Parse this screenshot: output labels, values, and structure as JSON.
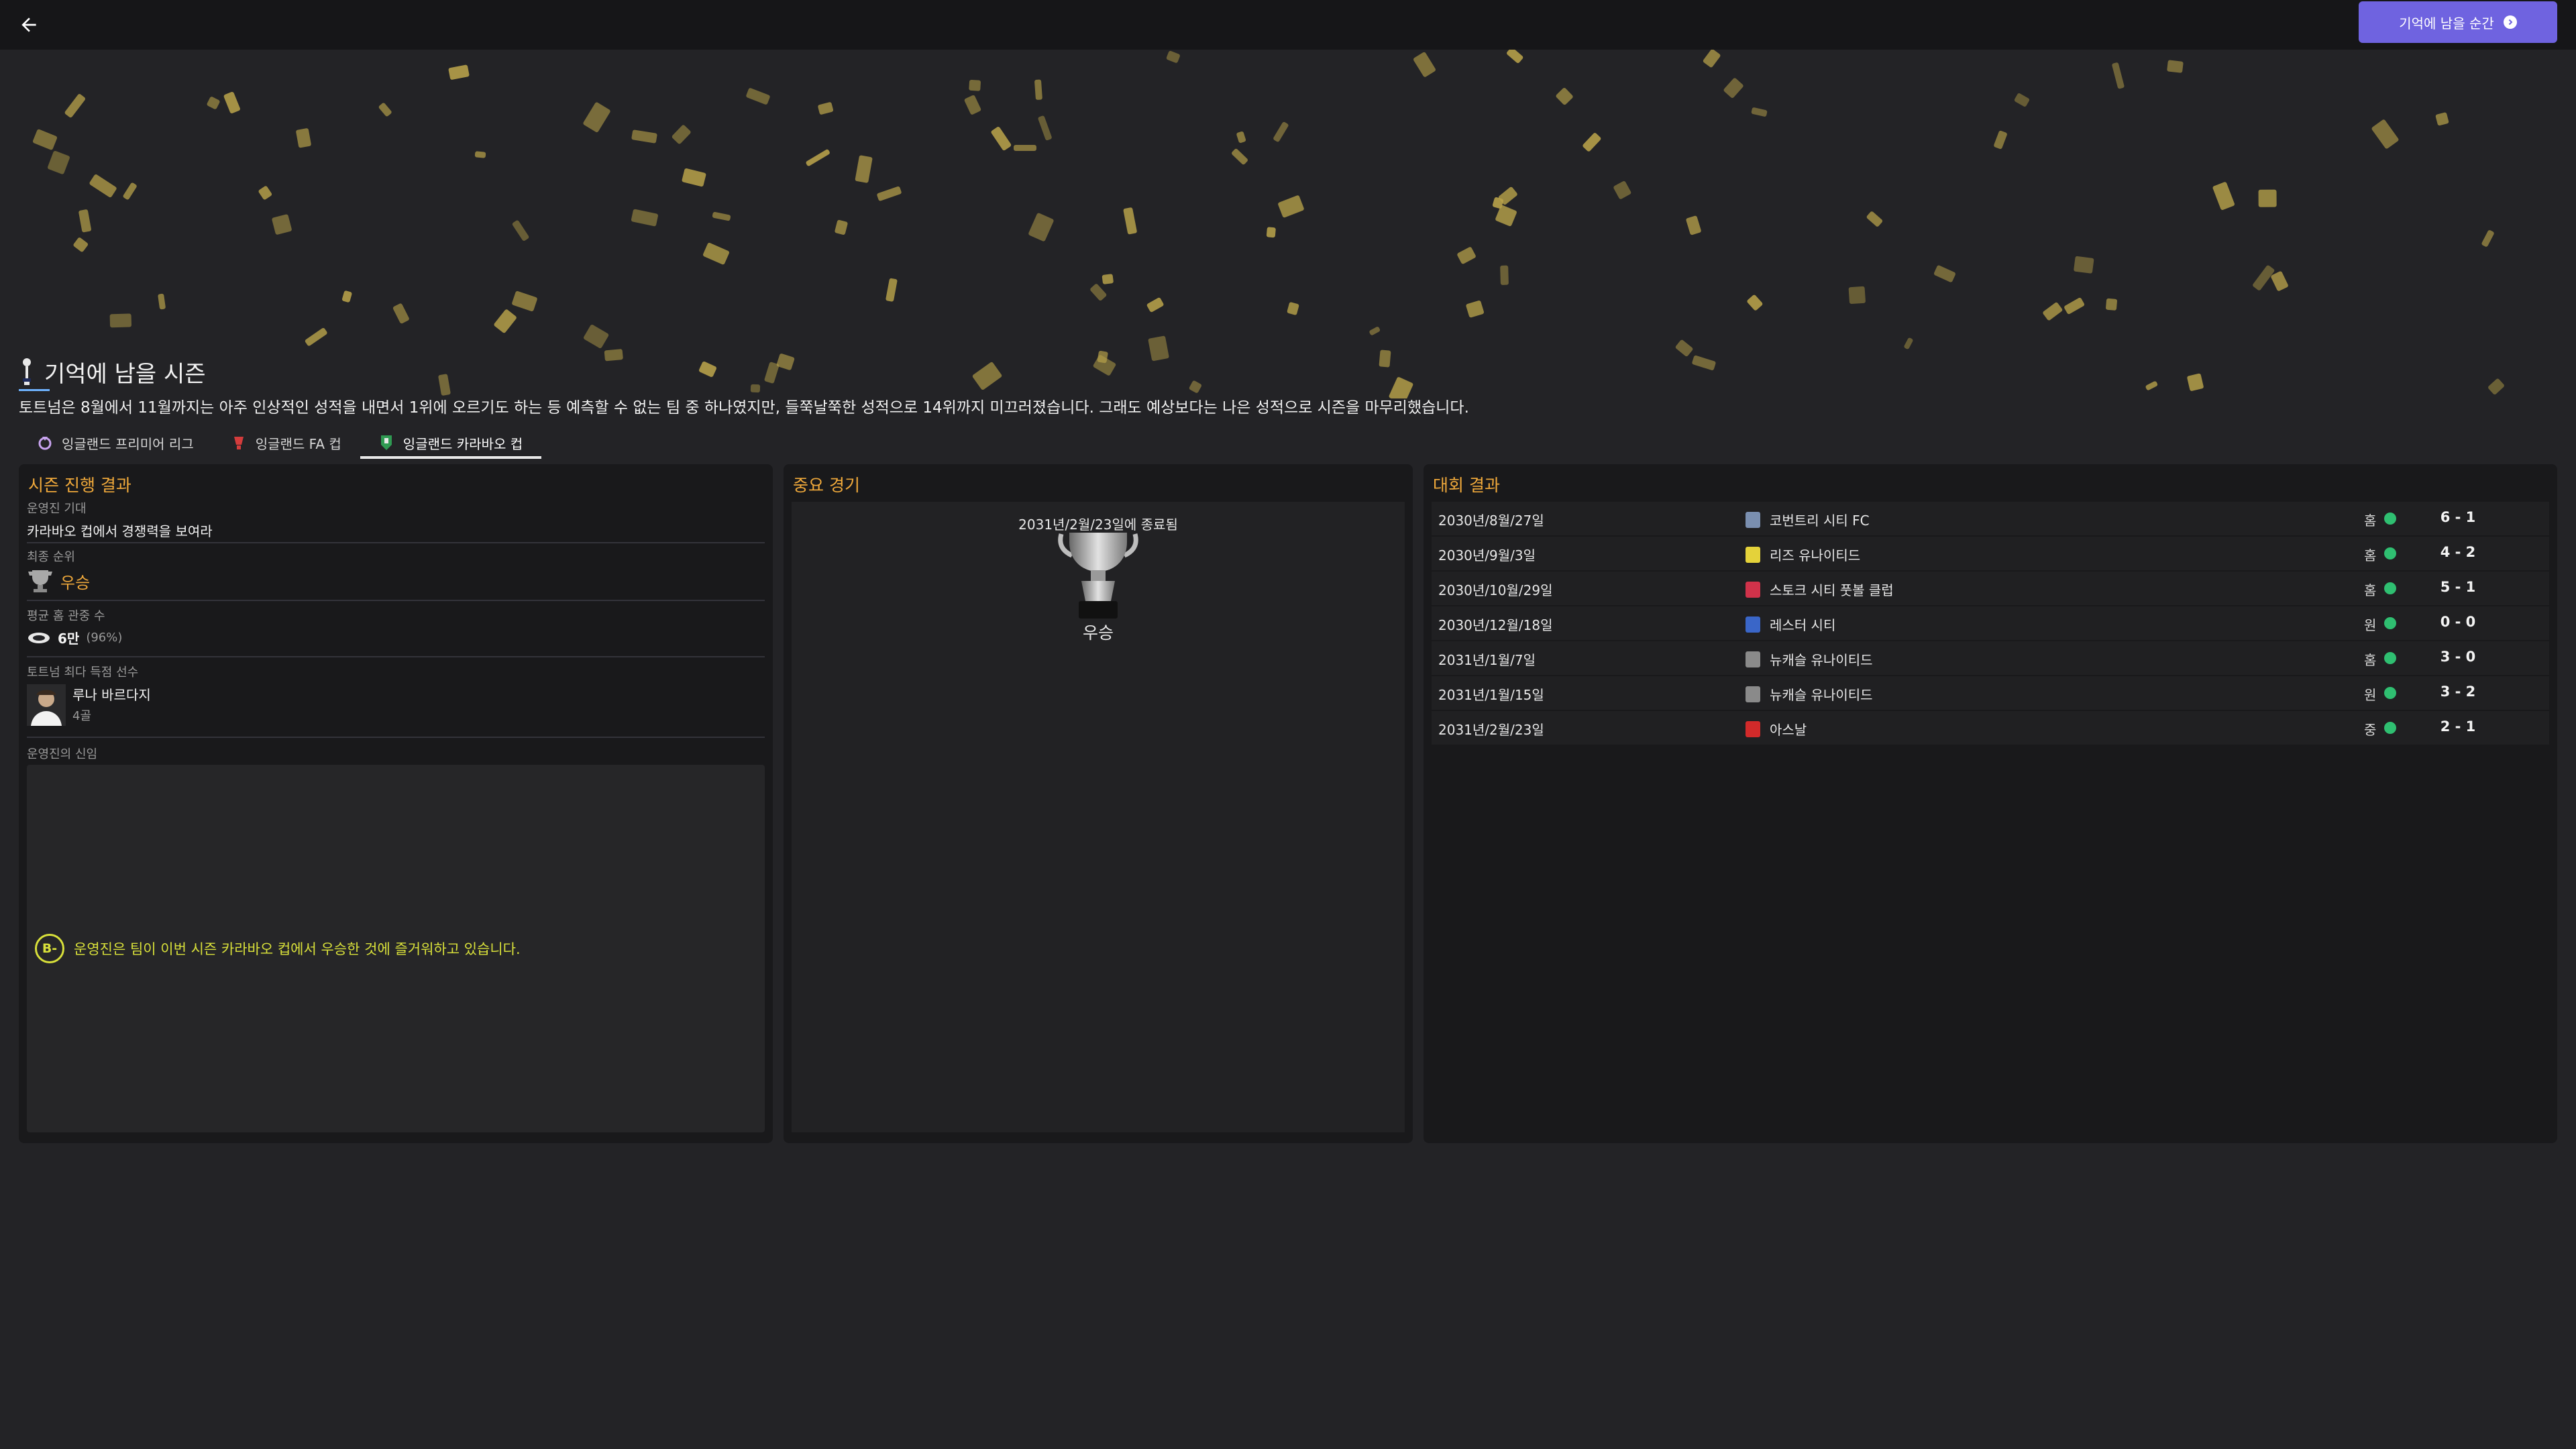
{
  "header": {
    "cta_label": "기억에 남을 순간"
  },
  "season": {
    "title": "기억에 남을 시즌",
    "summary": "토트넘은 8월에서 11월까지는 아주 인상적인 성적을 내면서 1위에 오르기도 하는 등 예측할 수 없는 팀 중 하나였지만, 들쭉날쭉한 성적으로 14위까지 미끄러졌습니다. 그래도 예상보다는 나은 성적으로 시즌을 마무리했습니다."
  },
  "tabs": [
    {
      "label": "잉글랜드 프리미어 리그",
      "icon": "premier-league-icon"
    },
    {
      "label": "잉글랜드 FA 컵",
      "icon": "fa-cup-icon"
    },
    {
      "label": "잉글랜드 카라바오 컵",
      "icon": "carabao-cup-icon",
      "active": true
    }
  ],
  "season_progress": {
    "title": "시즌 진행 결과",
    "expectation_label": "운영진 기대",
    "expectation_value": "카라바오 컵에서 경쟁력을 보여라",
    "final_position_label": "최종 순위",
    "final_position_value": "우승",
    "attendance_label": "평균 홈 관중 수",
    "attendance_value": "6만",
    "attendance_pct": "(96%)",
    "top_scorer_label": "토트넘 최다 득점 선수",
    "top_scorer_name": "루나 바르다지",
    "top_scorer_goals": "4골",
    "board_label": "운영진의 신임",
    "board_grade": "B-",
    "board_text": "운영진은 팀이 이번 시즌 카라바오 컵에서 우승한 것에 즐거워하고 있습니다."
  },
  "key_match": {
    "title": "중요 경기",
    "date": "2031년/2월/23일에 종료됨",
    "result": "우승"
  },
  "competition_results": {
    "title": "대회 결과",
    "rows": [
      {
        "date": "2030년/8월/27일",
        "team": "코번트리 시티 FC",
        "venue": "홈",
        "score": "6 - 1",
        "badge_color": "#7a8fb0"
      },
      {
        "date": "2030년/9월/3일",
        "team": "리즈 유나이티드",
        "venue": "홈",
        "score": "4 - 2",
        "badge_color": "#e4d23a"
      },
      {
        "date": "2030년/10월/29일",
        "team": "스토크 시티 풋볼 클럽",
        "venue": "홈",
        "score": "5 - 1",
        "badge_color": "#d0324a"
      },
      {
        "date": "2030년/12월/18일",
        "team": "레스터 시티",
        "venue": "원",
        "score": "0 - 0",
        "badge_color": "#3a66c8"
      },
      {
        "date": "2031년/1월/7일",
        "team": "뉴캐슬 유나이티드",
        "venue": "홈",
        "score": "3 - 0",
        "badge_color": "#8a8a8a"
      },
      {
        "date": "2031년/1월/15일",
        "team": "뉴캐슬 유나이티드",
        "venue": "원",
        "score": "3 - 2",
        "badge_color": "#8a8a8a"
      },
      {
        "date": "2031년/2월/23일",
        "team": "아스날",
        "venue": "중",
        "score": "2 - 1",
        "badge_color": "#d22a2a"
      }
    ]
  }
}
